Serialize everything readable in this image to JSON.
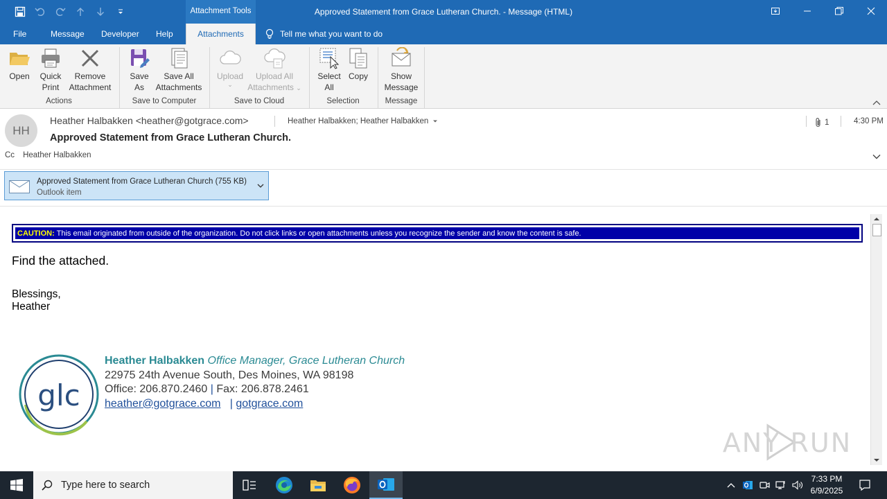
{
  "window": {
    "title": "Approved Statement from Grace Lutheran Church.  -  Message (HTML)",
    "context_tab": "Attachment Tools"
  },
  "tabs": [
    "File",
    "Message",
    "Developer",
    "Help",
    "Attachments"
  ],
  "tell_me": "Tell me what you want to do",
  "ribbon": {
    "open": "Open",
    "quick_print_1": "Quick",
    "quick_print_2": "Print",
    "remove_1": "Remove",
    "remove_2": "Attachment",
    "actions": "Actions",
    "save_as_1": "Save",
    "save_as_2": "As",
    "save_all_1": "Save All",
    "save_all_2": "Attachments",
    "save_to_computer": "Save to Computer",
    "upload": "Upload",
    "upload_all_1": "Upload All",
    "upload_all_2": "Attachments",
    "save_to_cloud": "Save to Cloud",
    "select_all_1": "Select",
    "select_all_2": "All",
    "copy": "Copy",
    "selection": "Selection",
    "show_message_1": "Show",
    "show_message_2": "Message",
    "message": "Message"
  },
  "header": {
    "avatar": "HH",
    "from": "Heather Halbakken <heather@gotgrace.com>",
    "to": "Heather Halbakken; Heather Halbakken",
    "subject": "Approved Statement from Grace Lutheran Church.",
    "cc_label": "Cc",
    "cc": "Heather Halbakken",
    "attachment_count": "1",
    "time": "4:30 PM"
  },
  "attachment": {
    "name": "Approved Statement from Grace Lutheran Church (755 KB)",
    "type": "Outlook item"
  },
  "body": {
    "caution_label": "CAUTION:",
    "caution_text": " This email originated from outside of the organization. Do not click links or open attachments unless you recognize the sender and know the content is safe.",
    "line1": "Find the attached.",
    "greeting": "Blessings,",
    "signoff": "Heather",
    "sig_name": "Heather Halbakken",
    "sig_role": "Office Manager, Grace Lutheran Church",
    "sig_address": "22975 24th Avenue South, Des Moines, WA  98198",
    "sig_phone": "Office:  206.870.2460",
    "sig_fax": "Fax:  206.878.2461",
    "sig_email": "heather@gotgrace.com",
    "sig_site": "gotgrace.com",
    "logo_text": "glc"
  },
  "watermark": "ANY RUN",
  "taskbar": {
    "search_placeholder": "Type here to search",
    "time": "7:33 PM",
    "date": "6/9/2025"
  },
  "colors": {
    "accent": "#1f6ab5",
    "caution_bg": "#0000a8",
    "caution_label": "#ffff00",
    "signature_teal": "#2a8a93",
    "link": "#1f4f9a"
  }
}
